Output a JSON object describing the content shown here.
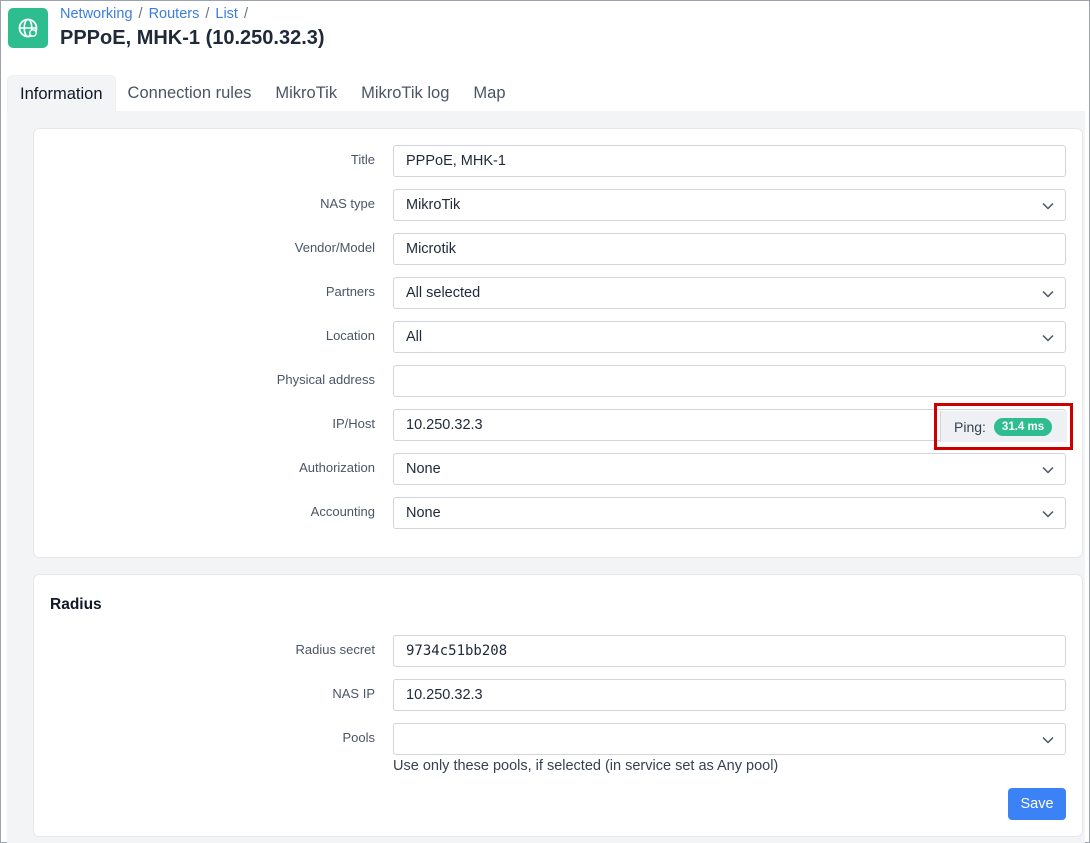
{
  "breadcrumb": [
    "Networking",
    "Routers",
    "List"
  ],
  "page_title": "PPPoE, MHK-1 (10.250.32.3)",
  "tabs": [
    "Information",
    "Connection rules",
    "MikroTik",
    "MikroTik log",
    "Map"
  ],
  "active_tab": "Information",
  "form": {
    "title": {
      "label": "Title",
      "value": "PPPoE, MHK-1"
    },
    "nas_type": {
      "label": "NAS type",
      "value": "MikroTik"
    },
    "vendor_model": {
      "label": "Vendor/Model",
      "value": "Microtik"
    },
    "partners": {
      "label": "Partners",
      "value": "All selected"
    },
    "location": {
      "label": "Location",
      "value": "All"
    },
    "physical_address": {
      "label": "Physical address",
      "value": ""
    },
    "ip_host": {
      "label": "IP/Host",
      "value": "10.250.32.3"
    },
    "authorization": {
      "label": "Authorization",
      "value": "None"
    },
    "accounting": {
      "label": "Accounting",
      "value": "None"
    }
  },
  "ping": {
    "label": "Ping:",
    "value": "31.4 ms"
  },
  "radius": {
    "section_title": "Radius",
    "secret": {
      "label": "Radius secret",
      "value": "9734c51bb208"
    },
    "nas_ip": {
      "label": "NAS IP",
      "value": "10.250.32.3"
    },
    "pools": {
      "label": "Pools",
      "value": "",
      "help": "Use only these pools, if selected (in service set as Any pool)"
    }
  },
  "save_label": "Save",
  "colors": {
    "accent": "#2dbd8e",
    "link": "#3b7ddd",
    "button": "#3b82f6",
    "highlight": "#cc0000"
  },
  "icons": {
    "app": "globe-icon",
    "dropdown": "chevron-down-icon"
  }
}
